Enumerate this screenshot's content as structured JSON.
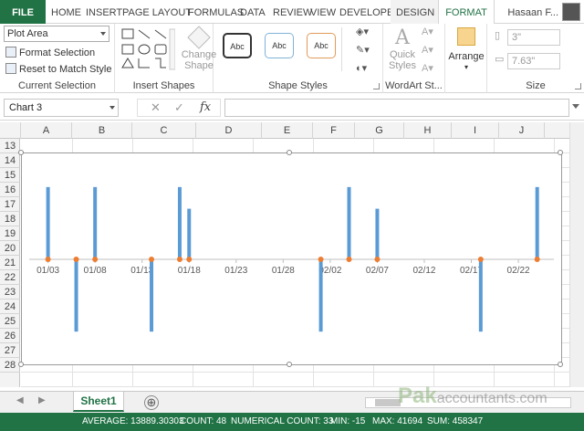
{
  "tabs": [
    {
      "label": "FILE",
      "left": 0
    },
    {
      "label": "HOME"
    },
    {
      "label": "INSERT"
    },
    {
      "label": "PAGE LAYOUT"
    },
    {
      "label": "FORMULAS"
    },
    {
      "label": "DATA"
    },
    {
      "label": "REVIEW"
    },
    {
      "label": "VIEW"
    },
    {
      "label": "DEVELOPER"
    },
    {
      "label": "DESIGN"
    },
    {
      "label": "FORMAT"
    }
  ],
  "user_name": "Hasaan F...",
  "ribbon": {
    "current_selection": {
      "selected_element": "Plot Area",
      "format_selection": "Format Selection",
      "reset_to_match_style": "Reset to Match Style",
      "label": "Current Selection"
    },
    "insert_shapes": {
      "change_shape_line1": "Change",
      "change_shape_line2": "Shape",
      "label": "Insert Shapes"
    },
    "shape_styles": {
      "style1": "Abc",
      "style2": "Abc",
      "style3": "Abc",
      "label": "Shape Styles"
    },
    "wordart": {
      "quick_styles_line1": "Quick",
      "quick_styles_line2": "Styles",
      "label": "WordArt St..."
    },
    "arrange": {
      "label": "Arrange"
    },
    "size": {
      "height": "3\"",
      "width": "7.63\"",
      "label": "Size"
    }
  },
  "formula_bar": {
    "name_box": "Chart 3",
    "fx": "fx"
  },
  "columns": [
    "A",
    "B",
    "C",
    "D",
    "E",
    "F",
    "G",
    "H",
    "I",
    "J"
  ],
  "rows": [
    "13",
    "14",
    "15",
    "16",
    "17",
    "18",
    "19",
    "20",
    "21",
    "22",
    "23",
    "24",
    "25",
    "26",
    "27",
    "28"
  ],
  "chart_data": {
    "type": "bar",
    "x": [
      "01/03",
      "01/06",
      "01/08",
      "01/14",
      "01/17",
      "01/18",
      "02/01",
      "02/04",
      "02/07",
      "02/18",
      "02/24"
    ],
    "values": [
      10,
      -10,
      10,
      -10,
      10,
      7,
      -10,
      10,
      7,
      -10,
      10
    ],
    "xticks": [
      "01/03",
      "01/08",
      "01/13",
      "01/18",
      "01/23",
      "01/28",
      "02/02",
      "02/07",
      "02/12",
      "02/17",
      "02/22"
    ],
    "xlim": [
      "01/01",
      "02/25"
    ],
    "ylim": [
      -12,
      12
    ],
    "bar_color": "#5b9bd5",
    "marker_color": "#ed7d31",
    "gridlines": false
  },
  "sheet_tabs": {
    "active": "Sheet1",
    "add": "⊕"
  },
  "watermark": {
    "main": "Pak",
    "sub": "accountants.com"
  },
  "status": {
    "average": "AVERAGE: 13889.30303",
    "count": "COUNT: 48",
    "numerical_count": "NUMERICAL COUNT: 33",
    "min": "MIN: -15",
    "max": "MAX: 41694",
    "sum": "SUM: 458347"
  },
  "colors": {
    "excel_green": "#217346"
  }
}
